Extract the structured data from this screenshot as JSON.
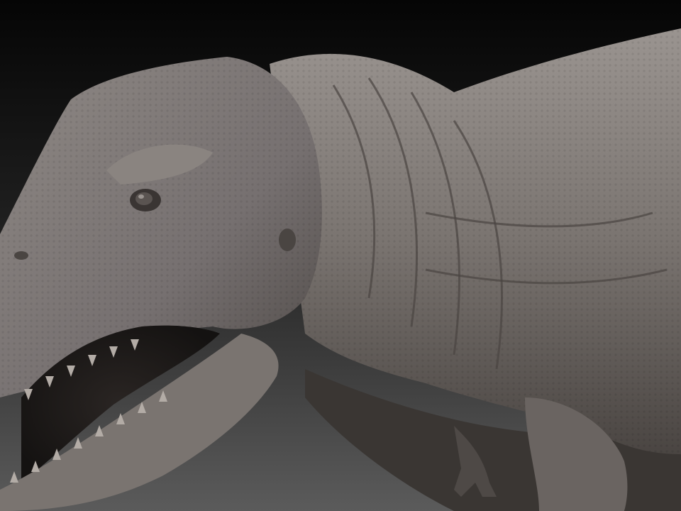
{
  "scene": {
    "subject": "sculpt-render",
    "colors": {
      "background_top": "#050505",
      "background_bottom": "#5b5b5b",
      "skin_light": "#9a9490",
      "skin_mid": "#6e6864",
      "skin_dark": "#3f3b39",
      "shadow": "#1d1b1a",
      "teeth": "#b3aca6"
    }
  }
}
